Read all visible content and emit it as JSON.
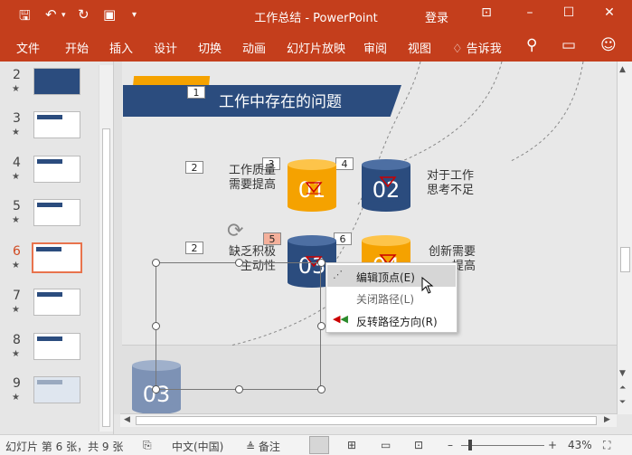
{
  "titlebar": {
    "title": "工作总结  -  PowerPoint",
    "login": "登录"
  },
  "ribbon": {
    "tabs": [
      "文件",
      "开始",
      "插入",
      "设计",
      "切换",
      "动画",
      "幻灯片放映",
      "审阅",
      "视图"
    ],
    "tell_me": "告诉我"
  },
  "thumbnails": [
    {
      "num": "2",
      "star": "★"
    },
    {
      "num": "3",
      "star": "★"
    },
    {
      "num": "4",
      "star": "★"
    },
    {
      "num": "5",
      "star": "★"
    },
    {
      "num": "6",
      "star": "★"
    },
    {
      "num": "7",
      "star": "★"
    },
    {
      "num": "8",
      "star": "★"
    },
    {
      "num": "9",
      "star": "★"
    }
  ],
  "slide": {
    "heading": "工作中存在的问题",
    "labels": [
      "1",
      "2",
      "3",
      "4",
      "2",
      "2",
      "5",
      "6",
      "2"
    ],
    "items": [
      {
        "num": "01",
        "text1": "工作质量",
        "text2": "需要提高"
      },
      {
        "num": "02",
        "text1": "对于工作",
        "text2": "思考不足"
      },
      {
        "num": "03",
        "text1": "缺乏积极",
        "text2": "主动性"
      },
      {
        "num": "04",
        "text1": "创新需要",
        "text2": "提高"
      }
    ],
    "floating_num": "03"
  },
  "context_menu": {
    "items": [
      {
        "label": "编辑顶点(E)",
        "selected": true,
        "enabled": true
      },
      {
        "label": "关闭路径(L)",
        "selected": false,
        "enabled": false
      },
      {
        "label": "反转路径方向(R)",
        "selected": false,
        "enabled": true
      }
    ]
  },
  "statusbar": {
    "slide_info": "幻灯片 第 6 张，共 9 张",
    "language": "中文(中国)",
    "notes": "备注",
    "zoom": "43%"
  },
  "colors": {
    "accent": "#c43e1c",
    "navy": "#2b4c7e",
    "orange": "#f5a200"
  }
}
